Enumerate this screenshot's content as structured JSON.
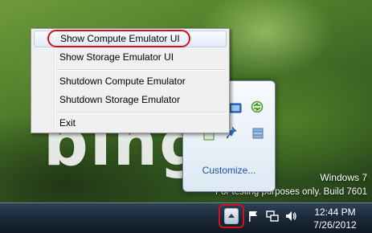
{
  "desktop": {
    "wallpaper_text": "bing",
    "watermark_line1": "Windows 7",
    "watermark_line2": "For testing purposes only. Build 7601"
  },
  "context_menu": {
    "items": [
      {
        "label": "Show Compute Emulator UI",
        "highlighted": true
      },
      {
        "label": "Show Storage Emulator UI"
      },
      {
        "label": "Shutdown Compute Emulator"
      },
      {
        "label": "Shutdown Storage Emulator"
      },
      {
        "label": "Exit"
      }
    ]
  },
  "overflow_flyout": {
    "icons": [
      "azure-emulator-icon",
      "sync-icon",
      "network-share-icon",
      "blue-pin-icon",
      "storage-icon"
    ],
    "customize_label": "Customize..."
  },
  "taskbar": {
    "tray_icons": [
      "show-hidden-icons-chevron",
      "flag-icon",
      "network-icon",
      "speaker-icon"
    ],
    "clock_time": "12:44 PM",
    "clock_date": "7/26/2012"
  },
  "colors": {
    "highlight_annotation": "#d6101a",
    "link": "#1f4f9e"
  }
}
